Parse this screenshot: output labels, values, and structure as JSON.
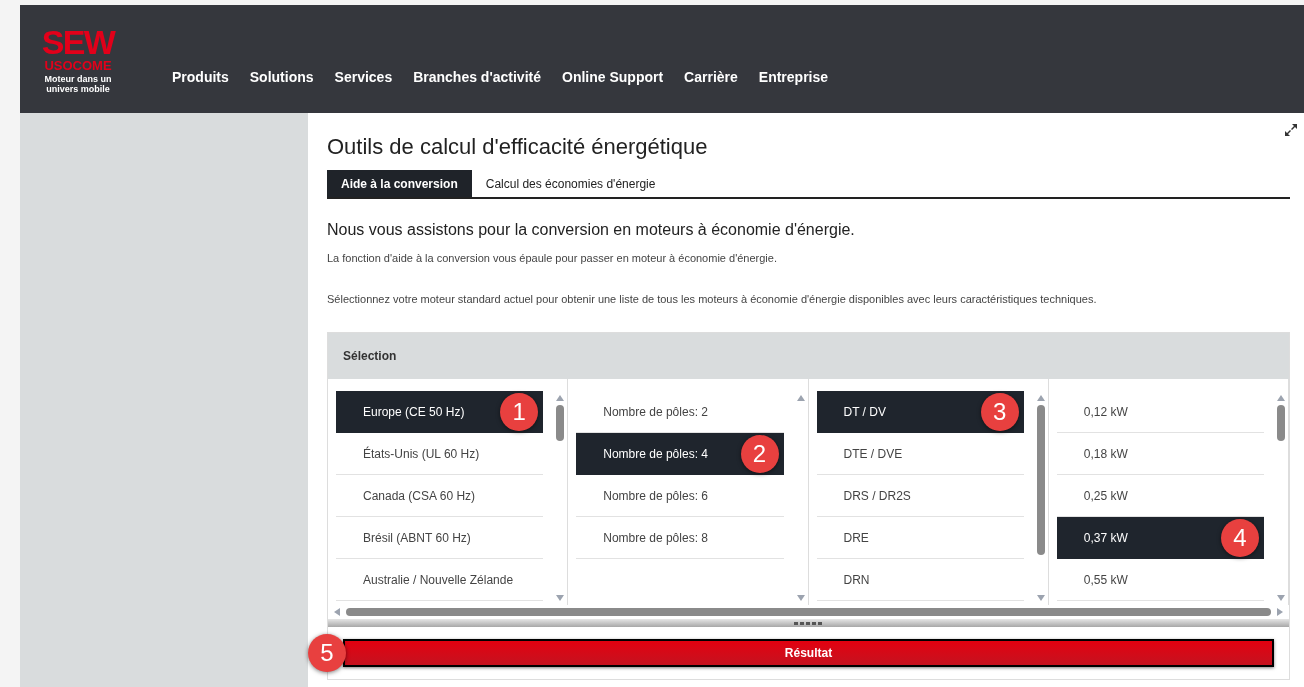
{
  "logo": {
    "brand": "SEW",
    "sub": "USOCOME",
    "tagline": "Moteur dans un univers mobile"
  },
  "nav": [
    "Produits",
    "Solutions",
    "Services",
    "Branches d'activité",
    "Online Support",
    "Carrière",
    "Entreprise"
  ],
  "title": "Outils de calcul d'efficacité énergétique",
  "tabs": [
    {
      "label": "Aide à la conversion",
      "selected": true
    },
    {
      "label": "Calcul des économies d'énergie",
      "selected": false
    }
  ],
  "heading": "Nous vous assistons pour la conversion en moteurs à économie d'énergie.",
  "paragraphs": [
    "La fonction d'aide à la conversion vous épaule pour passer en moteur à économie d'énergie.",
    "Sélectionnez votre moteur standard actuel pour obtenir une liste de tous les moteurs à économie d'énergie disponibles avec leurs caractéristiques techniques."
  ],
  "selection": {
    "title": "Sélection",
    "columns": [
      {
        "marker": "1",
        "items": [
          {
            "label": "Europe (CE 50 Hz)",
            "selected": true
          },
          {
            "label": "États-Unis (UL 60 Hz)",
            "selected": false
          },
          {
            "label": "Canada (CSA 60 Hz)",
            "selected": false
          },
          {
            "label": "Brésil (ABNT 60 Hz)",
            "selected": false
          },
          {
            "label": "Australie / Nouvelle Zélande",
            "selected": false
          }
        ]
      },
      {
        "marker": "2",
        "items": [
          {
            "label": "Nombre de pôles: 2",
            "selected": false
          },
          {
            "label": "Nombre de pôles: 4",
            "selected": true
          },
          {
            "label": "Nombre de pôles: 6",
            "selected": false
          },
          {
            "label": "Nombre de pôles: 8",
            "selected": false
          }
        ]
      },
      {
        "marker": "3",
        "items": [
          {
            "label": "DT / DV",
            "selected": true
          },
          {
            "label": "DTE / DVE",
            "selected": false
          },
          {
            "label": "DRS / DR2S",
            "selected": false
          },
          {
            "label": "DRE",
            "selected": false
          },
          {
            "label": "DRN",
            "selected": false
          }
        ]
      },
      {
        "marker": "4",
        "items": [
          {
            "label": "0,12 kW",
            "selected": false
          },
          {
            "label": "0,18 kW",
            "selected": false
          },
          {
            "label": "0,25 kW",
            "selected": false
          },
          {
            "label": "0,37 kW",
            "selected": true
          },
          {
            "label": "0,55 kW",
            "selected": false
          }
        ]
      }
    ]
  },
  "result": {
    "marker": "5",
    "label": "Résultat"
  }
}
